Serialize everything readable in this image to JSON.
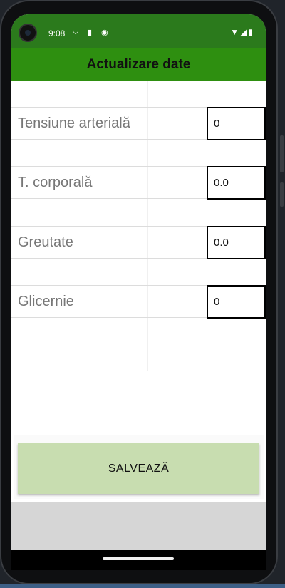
{
  "status_bar": {
    "time": "9:08",
    "left_icons": [
      "shield-icon",
      "sd-card-icon",
      "notification-icon"
    ],
    "right_icons": [
      "wifi-icon",
      "signal-icon",
      "battery-icon"
    ]
  },
  "app_bar": {
    "title": "Actualizare date"
  },
  "form": {
    "rows": [
      {
        "label": "Tensiune arterială",
        "value": "0"
      },
      {
        "label": "T. corporală",
        "value": "0.0"
      },
      {
        "label": "Greutate",
        "value": "0.0"
      },
      {
        "label": "Glicernie",
        "value": "0"
      }
    ],
    "save_label": "SALVEAZĂ"
  },
  "colors": {
    "status_bar": "#2b7a1c",
    "app_bar": "#2e8f10",
    "save_button": "#c8ddb0"
  }
}
